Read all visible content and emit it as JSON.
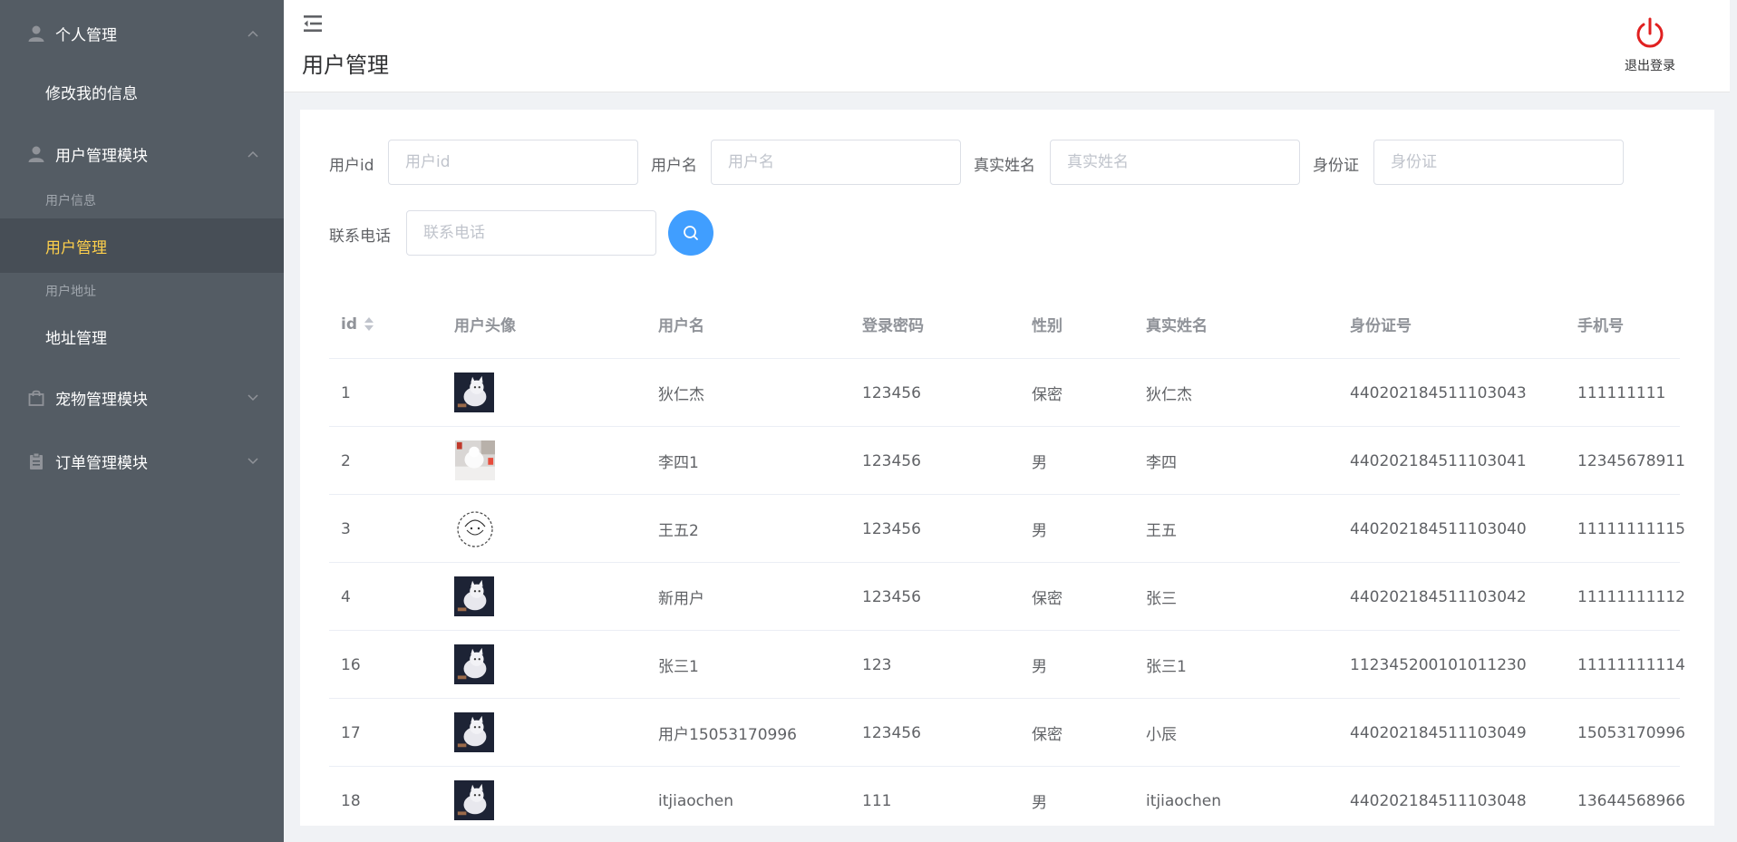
{
  "sidebar": {
    "groups": [
      {
        "label": "个人管理",
        "items": [
          {
            "label": "修改我的信息"
          }
        ]
      },
      {
        "label": "用户管理模块",
        "sections": [
          {
            "title": "用户信息",
            "items": [
              {
                "label": "用户管理"
              }
            ]
          },
          {
            "title": "用户地址",
            "items": [
              {
                "label": "地址管理"
              }
            ]
          }
        ]
      },
      {
        "label": "宠物管理模块"
      },
      {
        "label": "订单管理模块"
      }
    ],
    "colors": {
      "background": "#545c64",
      "active_background": "#474e56",
      "active_text": "#ffd04b"
    }
  },
  "header": {
    "title": "用户管理",
    "logout_label": "退出登录",
    "logout_color": "#e02020"
  },
  "filters": {
    "user_id": {
      "label": "用户id",
      "placeholder": "用户id"
    },
    "username": {
      "label": "用户名",
      "placeholder": "用户名"
    },
    "real_name": {
      "label": "真实姓名",
      "placeholder": "真实姓名"
    },
    "id_card": {
      "label": "身份证",
      "placeholder": "身份证"
    },
    "phone": {
      "label": "联系电话",
      "placeholder": "联系电话"
    },
    "search_icon": "search-icon",
    "search_color": "#409eff"
  },
  "table": {
    "headers": {
      "id": "id",
      "avatar": "用户头像",
      "username": "用户名",
      "password": "登录密码",
      "gender": "性别",
      "real_name": "真实姓名",
      "id_card": "身份证号",
      "phone": "手机号"
    },
    "rows": [
      {
        "id": "1",
        "avatar": "cat",
        "username": "狄仁杰",
        "password": "123456",
        "gender": "保密",
        "real_name": "狄仁杰",
        "id_card": "440202184511103043",
        "phone": "111111111"
      },
      {
        "id": "2",
        "avatar": "white-cat-photo",
        "username": "李四1",
        "password": "123456",
        "gender": "男",
        "real_name": "李四",
        "id_card": "440202184511103041",
        "phone": "12345678911"
      },
      {
        "id": "3",
        "avatar": "sketch",
        "username": "王五2",
        "password": "123456",
        "gender": "男",
        "real_name": "王五",
        "id_card": "440202184511103040",
        "phone": "11111111115"
      },
      {
        "id": "4",
        "avatar": "cat",
        "username": "新用户",
        "password": "123456",
        "gender": "保密",
        "real_name": "张三",
        "id_card": "440202184511103042",
        "phone": "11111111112"
      },
      {
        "id": "16",
        "avatar": "cat",
        "username": "张三1",
        "password": "123",
        "gender": "男",
        "real_name": "张三1",
        "id_card": "112345200101011230",
        "phone": "11111111114"
      },
      {
        "id": "17",
        "avatar": "cat",
        "username": "用户15053170996",
        "password": "123456",
        "gender": "保密",
        "real_name": "小辰",
        "id_card": "440202184511103049",
        "phone": "15053170996"
      },
      {
        "id": "18",
        "avatar": "cat",
        "username": "itjiaochen",
        "password": "111",
        "gender": "男",
        "real_name": "itjiaochen",
        "id_card": "440202184511103048",
        "phone": "13644568966"
      }
    ]
  }
}
